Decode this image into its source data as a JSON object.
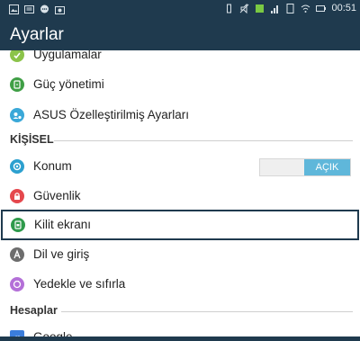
{
  "status_bar": {
    "left_icons": [
      "gallery-icon",
      "message-icon",
      "chat-icon",
      "photo-icon"
    ],
    "right_icons": [
      "vibrate-icon",
      "mute-icon",
      "battery-saver-icon",
      "signal-icon",
      "sim-icon",
      "wifi-icon",
      "battery-icon"
    ],
    "time": "00:51"
  },
  "header": {
    "title": "Ayarlar"
  },
  "items": [
    {
      "label": "Uygulamalar",
      "icon": "apps-icon",
      "color": "#8bc34a"
    },
    {
      "label": "Güç yönetimi",
      "icon": "power-icon",
      "color": "#3f9f45"
    },
    {
      "label": "ASUS Özelleştirilmiş Ayarları",
      "icon": "asus-settings-icon",
      "color": "#3aa8d8"
    }
  ],
  "section_personal": {
    "label": "KİŞİSEL"
  },
  "personal_items": [
    {
      "label": "Konum",
      "icon": "location-icon",
      "color": "#2ca0cf",
      "toggle": "AÇIK"
    },
    {
      "label": "Güvenlik",
      "icon": "security-icon",
      "color": "#e5484d"
    },
    {
      "label": "Kilit ekranı",
      "icon": "lock-screen-icon",
      "color": "#2e9a4b",
      "selected": true
    },
    {
      "label": "Dil ve giriş",
      "icon": "language-icon",
      "color": "#6d6d6d"
    },
    {
      "label": "Yedekle ve sıfırla",
      "icon": "backup-icon",
      "color": "#b470d8"
    }
  ],
  "section_accounts": {
    "label": "Hesaplar"
  },
  "account_items": [
    {
      "label": "Google",
      "icon": "google-icon",
      "color": "#3b7ddb"
    }
  ],
  "colors": {
    "bar": "#1f3a4e",
    "toggle_on": "#5fb7da"
  }
}
